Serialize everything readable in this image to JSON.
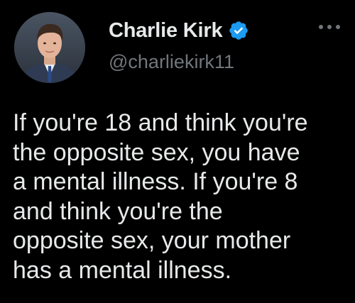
{
  "author": {
    "display_name": "Charlie Kirk",
    "handle": "@charliekirk11",
    "verified": true,
    "avatar_icon": "profile-photo",
    "verified_icon": "verified-badge-icon",
    "verified_color": "#1d9bf0"
  },
  "menu": {
    "icon": "more-options-icon"
  },
  "tweet": {
    "text": "If you're 18 and think you're\nthe opposite sex, you have\na mental illness. If you're 8\nand think you're the\nopposite sex, your mother\nhas a mental illness."
  },
  "colors": {
    "background": "#000000",
    "primary_text": "#e7e9ea",
    "secondary_text": "#71767b",
    "accent": "#1d9bf0"
  }
}
